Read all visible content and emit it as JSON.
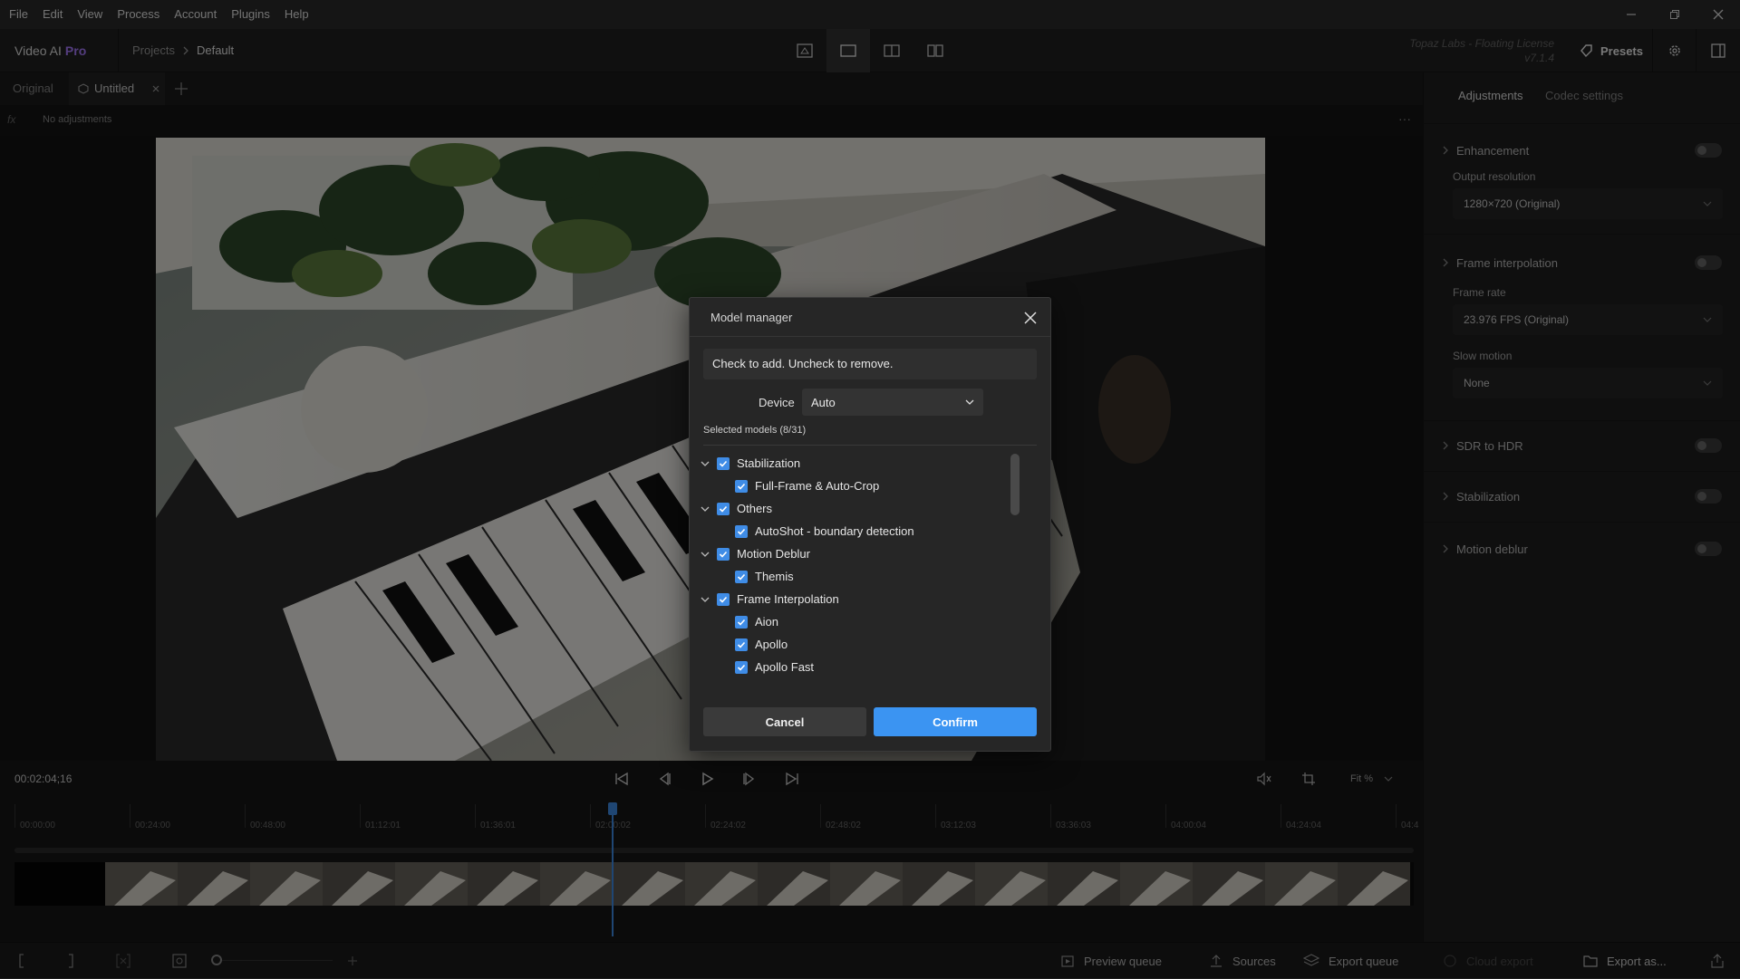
{
  "menu": [
    "File",
    "Edit",
    "View",
    "Process",
    "Account",
    "Plugins",
    "Help"
  ],
  "header": {
    "app_name": "Video AI",
    "edition": "Pro",
    "breadcrumb": [
      "Projects",
      "Default"
    ],
    "license_line1": "Topaz Labs - Floating License",
    "license_line2": "v7.1.4",
    "presets_label": "Presets"
  },
  "tabs": {
    "original": "Original",
    "untitled": "Untitled"
  },
  "adjustments_row": {
    "fx": "fx",
    "text": "No adjustments",
    "more": "···"
  },
  "right_panel": {
    "tabs": [
      "Adjustments",
      "Codec settings"
    ],
    "enhancement": "Enhancement",
    "output_resolution_label": "Output resolution",
    "output_resolution_value": "1280×720 (Original)",
    "frame_interpolation": "Frame interpolation",
    "frame_rate_label": "Frame rate",
    "frame_rate_value": "23.976 FPS (Original)",
    "slow_motion_label": "Slow motion",
    "slow_motion_value": "None",
    "sdr_to_hdr": "SDR to HDR",
    "stabilization": "Stabilization",
    "motion_deblur": "Motion deblur"
  },
  "transport": {
    "timecode": "00:02:04;16",
    "zoom": "Fit %"
  },
  "timeline": {
    "ticks": [
      "00:00:00",
      "00:24:00",
      "00:48:00",
      "01:12:01",
      "01:36:01",
      "02:00:02",
      "02:24:02",
      "02:48:02",
      "03:12:03",
      "03:36:03",
      "04:00:04",
      "04:24:04",
      "04:4"
    ],
    "playhead_fraction": 0.427
  },
  "bottom_bar": {
    "preview_queue": "Preview queue",
    "sources": "Sources",
    "export_queue": "Export queue",
    "cloud_export": "Cloud export",
    "export_as": "Export as..."
  },
  "dialog": {
    "title": "Model manager",
    "info": "Check to add. Uncheck to remove.",
    "device_label": "Device",
    "device_value": "Auto",
    "selected": "Selected models (8/31)",
    "groups": [
      {
        "name": "Stabilization",
        "items": [
          "Full-Frame & Auto-Crop"
        ]
      },
      {
        "name": "Others",
        "items": [
          "AutoShot - boundary detection"
        ]
      },
      {
        "name": "Motion Deblur",
        "items": [
          "Themis"
        ]
      },
      {
        "name": "Frame Interpolation",
        "items": [
          "Aion",
          "Apollo",
          "Apollo Fast"
        ]
      }
    ],
    "cancel": "Cancel",
    "confirm": "Confirm"
  }
}
